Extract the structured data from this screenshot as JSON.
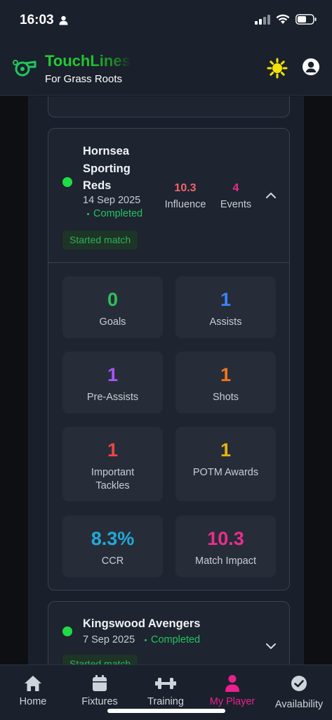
{
  "status_bar": {
    "time": "16:03"
  },
  "header": {
    "title": "TouchLines",
    "subtitle": "For Grass Roots"
  },
  "colors": {
    "accent_green": "#22c55e",
    "active_nav": "#e9218c",
    "background": "#111620"
  },
  "match": {
    "opponent": "Hornsea Sporting Reds",
    "date": "14 Sep 2025",
    "status": "Completed",
    "influence_value": "10.3",
    "influence_label": "Influence",
    "events_value": "4",
    "events_label": "Events",
    "badge": "Started match",
    "stats": [
      {
        "value": "0",
        "label": "Goals",
        "color": "#2fbf5a"
      },
      {
        "value": "1",
        "label": "Assists",
        "color": "#3b82f6"
      },
      {
        "value": "1",
        "label": "Pre-Assists",
        "color": "#a855f7"
      },
      {
        "value": "1",
        "label": "Shots",
        "color": "#f2751a"
      },
      {
        "value": "1",
        "label": "Important Tackles",
        "color": "#ef4444"
      },
      {
        "value": "1",
        "label": "POTM Awards",
        "color": "#e8b40c"
      },
      {
        "value": "8.3%",
        "label": "CCR",
        "color": "#23a9d6"
      },
      {
        "value": "10.3",
        "label": "Match Impact",
        "color": "#ec2d8b"
      }
    ]
  },
  "next_match": {
    "opponent": "Kingswood Avengers",
    "date": "7 Sep 2025",
    "status": "Completed",
    "badge": "Started match"
  },
  "nav": {
    "items": [
      {
        "label": "Home",
        "icon": "home-icon"
      },
      {
        "label": "Fixtures",
        "icon": "calendar-icon"
      },
      {
        "label": "Training",
        "icon": "dumbbell-icon"
      },
      {
        "label": "My Player",
        "icon": "person-icon"
      },
      {
        "label": "Availability",
        "icon": "check-circle-icon"
      }
    ],
    "active": "My Player"
  }
}
